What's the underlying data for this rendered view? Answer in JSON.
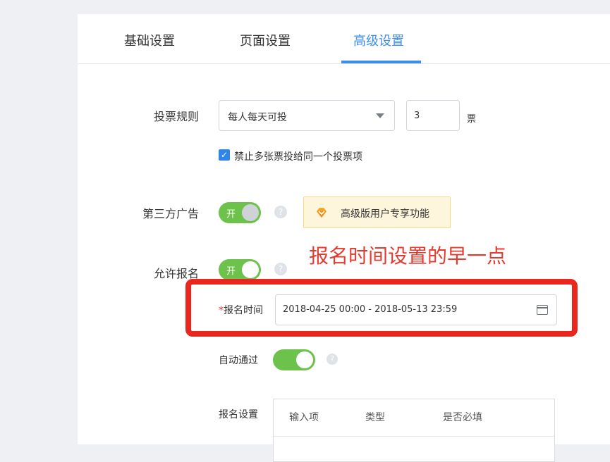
{
  "tabs": [
    {
      "label": "基础设置",
      "active": false
    },
    {
      "label": "页面设置",
      "active": false
    },
    {
      "label": "高级设置",
      "active": true
    }
  ],
  "vote_rule": {
    "label": "投票规则",
    "select_value": "每人每天可投",
    "count_value": "3",
    "unit": "票",
    "checkbox_label": "禁止多张票投给同一个投票项",
    "checkbox_checked": true
  },
  "third_party_ad": {
    "label": "第三方广告",
    "switch_text": "开",
    "help_icon": "?",
    "pro_badge_text": "高级版用户专享功能"
  },
  "annotation": "报名时间设置的早一点",
  "allow_signup": {
    "label": "允许报名",
    "switch_text": "开",
    "help_icon": "?",
    "signup_time_required": "*",
    "signup_time_label": "报名时间",
    "signup_time_value": "2018-04-25 00:00 - 2018-05-13 23:59",
    "auto_approve_label": "自动通过",
    "auto_approve_help": "?",
    "signup_settings_label": "报名设置",
    "table_headers": [
      "输入项",
      "类型",
      "是否必填"
    ]
  },
  "colors": {
    "accent": "#3d8ee8",
    "switch_on": "#6cc24a",
    "annotation_red": "#e63a2e"
  }
}
